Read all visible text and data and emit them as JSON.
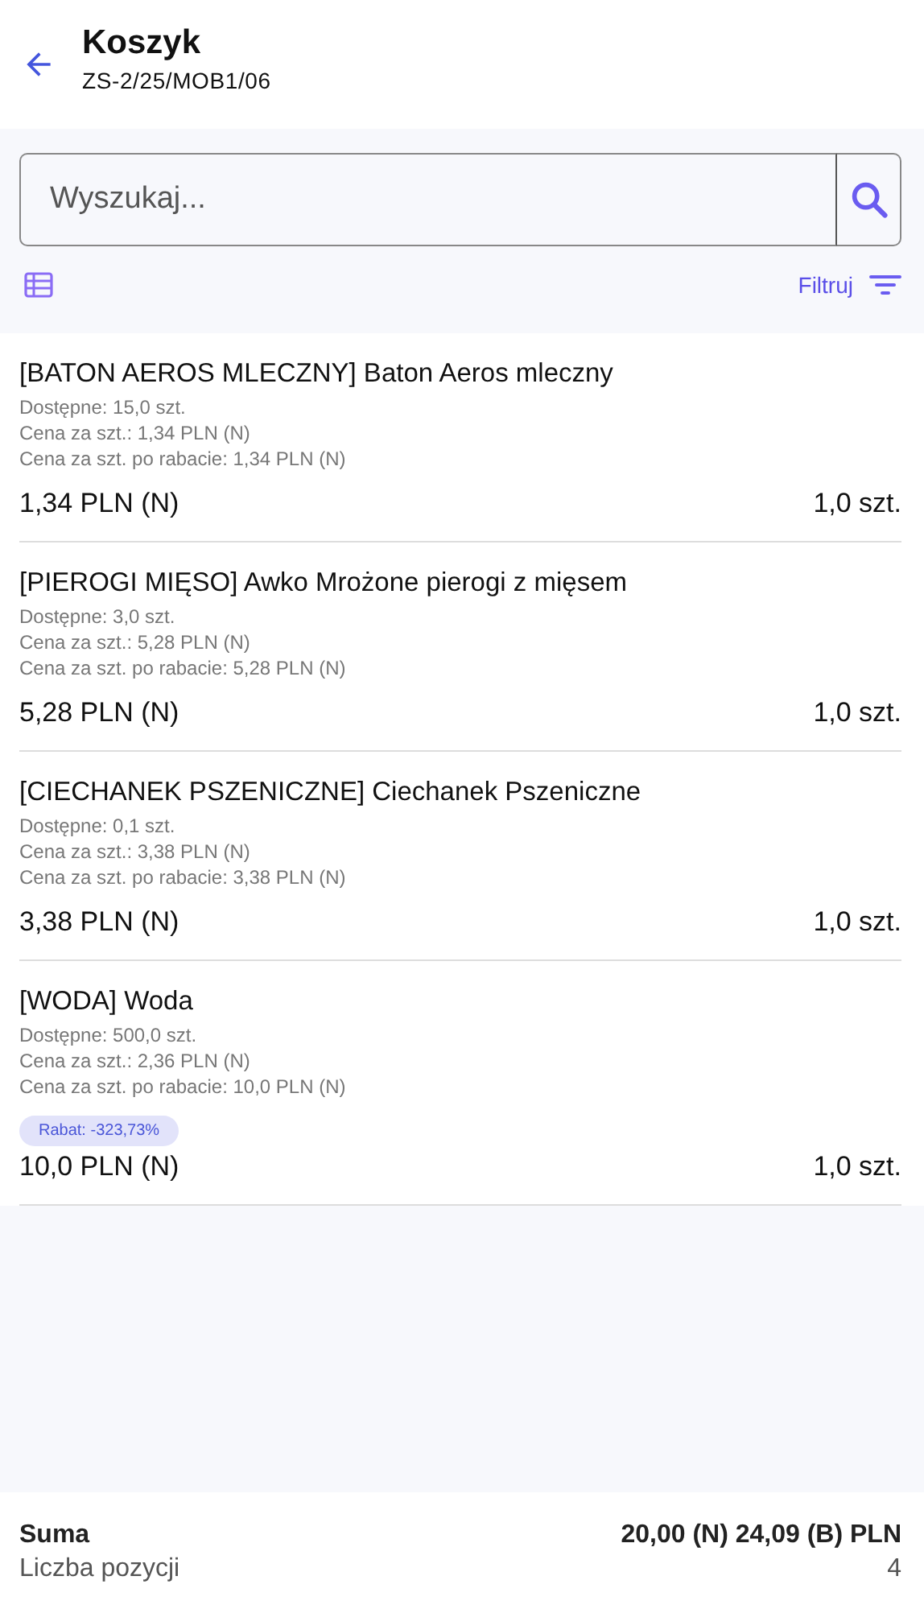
{
  "header": {
    "title": "Koszyk",
    "subtitle": "ZS-2/25/MOB1/06"
  },
  "search": {
    "placeholder": "Wyszukaj..."
  },
  "toolbar": {
    "filter_label": "Filtruj"
  },
  "items": [
    {
      "name": "[BATON AEROS MLECZNY] Baton Aeros mleczny",
      "details": [
        "Dostępne: 15,0 szt.",
        "Cena za szt.: 1,34 PLN (N)",
        "Cena za szt. po rabacie: 1,34 PLN (N)"
      ],
      "price": "1,34 PLN (N)",
      "quantity": "1,0 szt."
    },
    {
      "name": "[PIEROGI MIĘSO] Awko Mrożone pierogi z mięsem",
      "details": [
        "Dostępne: 3,0 szt.",
        "Cena za szt.: 5,28 PLN (N)",
        "Cena za szt. po rabacie: 5,28 PLN (N)"
      ],
      "price": "5,28 PLN (N)",
      "quantity": "1,0 szt."
    },
    {
      "name": "[CIECHANEK PSZENICZNE] Ciechanek Pszeniczne",
      "details": [
        "Dostępne: 0,1 szt.",
        "Cena za szt.: 3,38 PLN (N)",
        "Cena za szt. po rabacie: 3,38 PLN (N)"
      ],
      "price": "3,38 PLN (N)",
      "quantity": "1,0 szt."
    },
    {
      "name": "[WODA] Woda",
      "details": [
        "Dostępne: 500,0 szt.",
        "Cena za szt.: 2,36 PLN (N)",
        "Cena za szt. po rabacie: 10,0 PLN (N)"
      ],
      "discount": "Rabat: -323,73%",
      "price": "10,0 PLN (N)",
      "quantity": "1,0 szt."
    }
  ],
  "summary": [
    {
      "label": "Suma",
      "value": "20,00 (N) 24,09 (B) PLN",
      "kind": "total"
    },
    {
      "label": "Liczba pozycji",
      "value": "4",
      "kind": "count"
    }
  ]
}
